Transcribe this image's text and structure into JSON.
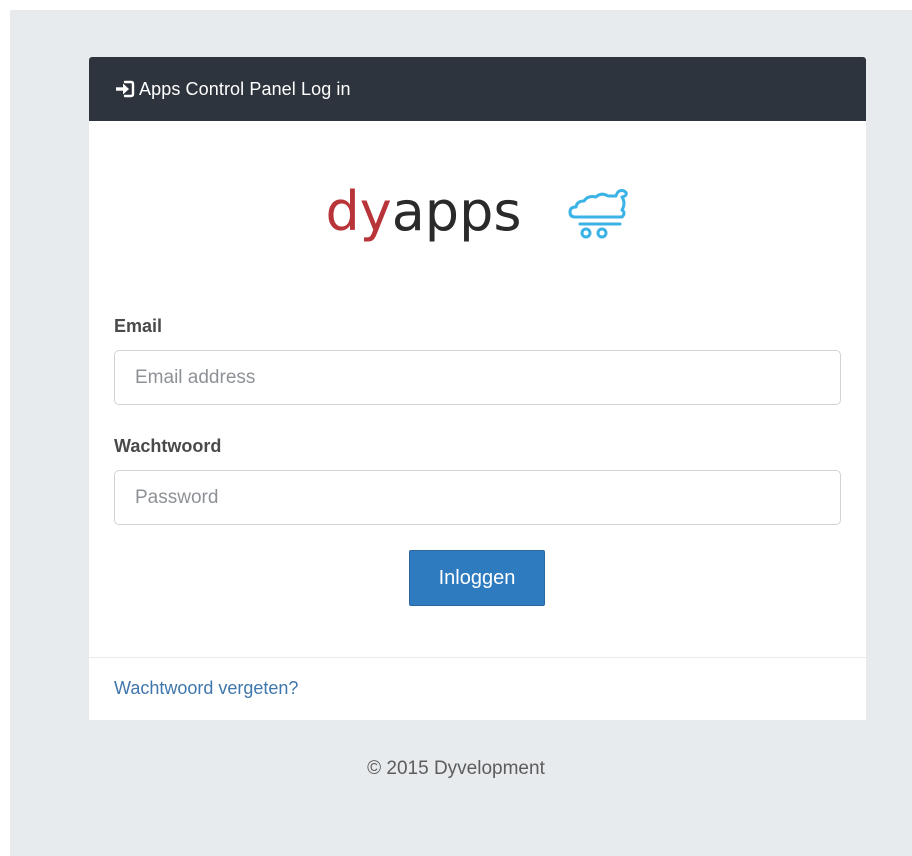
{
  "header": {
    "icon": "sign-in-icon",
    "title": "Apps Control Panel Log in"
  },
  "logo": {
    "part_red": "dy",
    "part_dark": "apps",
    "mark_icon": "cloud-cart-icon",
    "colors": {
      "red": "#b93438",
      "dark": "#2a2a2a",
      "mark": "#3bb3e6"
    }
  },
  "form": {
    "email_label": "Email",
    "email_placeholder": "Email address",
    "email_value": "",
    "password_label": "Wachtwoord",
    "password_placeholder": "Password",
    "password_value": "",
    "submit_label": "Inloggen"
  },
  "links": {
    "forgot_password": "Wachtwoord vergeten?"
  },
  "footer": {
    "copyright": "© 2015 Dyvelopment"
  },
  "colors": {
    "header_bg": "#2d343d",
    "page_bg": "#e8ebee",
    "button_bg": "#2f7bbf",
    "link": "#3f76ac"
  }
}
